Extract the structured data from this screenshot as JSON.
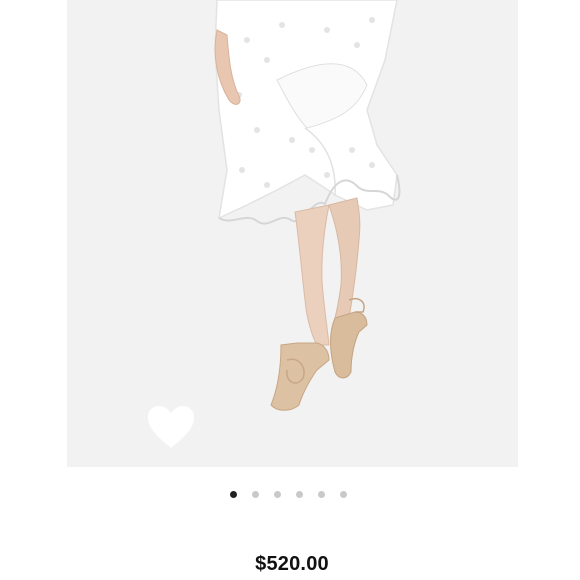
{
  "product": {
    "image_icon": "product-photo-white-eyelet-skirt",
    "price": "$520.00"
  },
  "carousel": {
    "total": 6,
    "active": 1
  },
  "favorite": {
    "icon": "heart-icon",
    "color": "#ffffff"
  },
  "colors": {
    "dot_active": "#222222",
    "dot_inactive": "#c9c9c9",
    "photo_background": "#f2f2f2"
  }
}
